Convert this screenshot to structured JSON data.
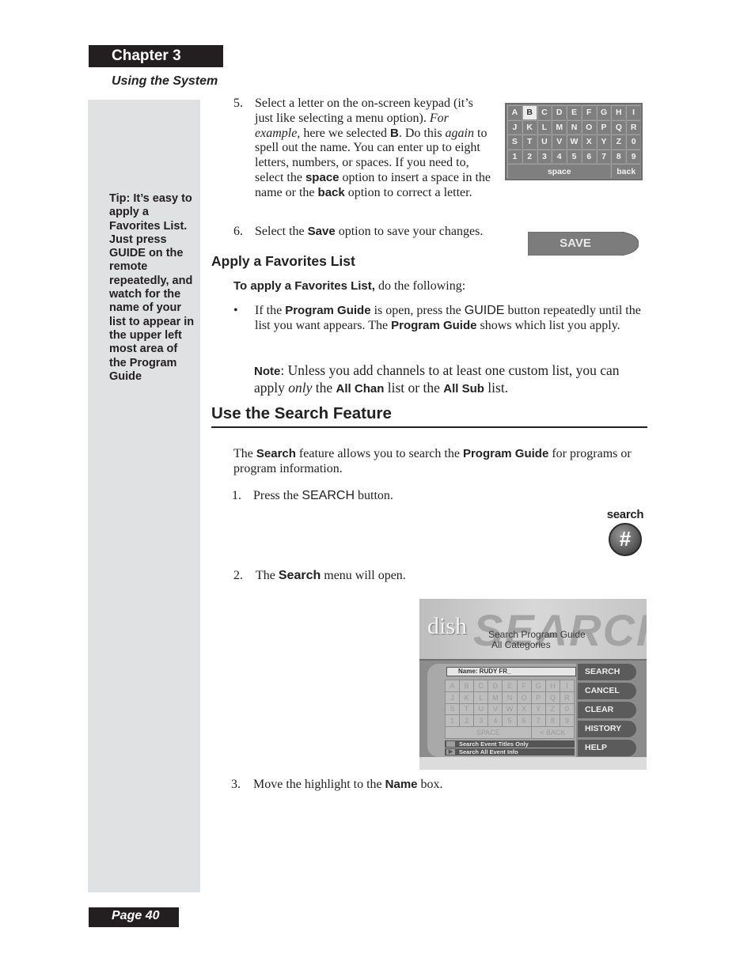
{
  "header": {
    "chapter": "Chapter 3",
    "section": "Using the System"
  },
  "sidebar": {
    "tip": "Tip: It’s easy to apply a Favorites List. Just press GUIDE on the remote repeatedly, and watch for the name of your list to appear in the upper left most area of the Program Guide"
  },
  "step5": {
    "number": "5.",
    "t1": "Select a letter on the on-screen keypad (it’s just like selecting a menu option). ",
    "t2": "For example,",
    "t3": " here we selected ",
    "t4": "B",
    "t5": ". Do this ",
    "t6": "again",
    "t7": " to spell out the name. You can enter up to eight letters, numbers, or spaces. If you need to, select the ",
    "t8": "space",
    "t9": " option to insert a space in the name or the ",
    "t10": "back",
    "t11": " option to correct a letter."
  },
  "keypad": {
    "keys": [
      "A",
      "B",
      "C",
      "D",
      "E",
      "F",
      "G",
      "H",
      "I",
      "J",
      "K",
      "L",
      "M",
      "N",
      "O",
      "P",
      "Q",
      "R",
      "S",
      "T",
      "U",
      "V",
      "W",
      "X",
      "Y",
      "Z",
      "0",
      "1",
      "2",
      "3",
      "4",
      "5",
      "6",
      "7",
      "8",
      "9"
    ],
    "selected": "B",
    "space": "space",
    "back": "back"
  },
  "step6": {
    "number": "6.",
    "t1": "Select the ",
    "t2": "Save",
    "t3": " option to save your changes."
  },
  "save_button": {
    "label": "SAVE"
  },
  "favorites": {
    "heading": "Apply a Favorites List",
    "intro_bold": "To apply a Favorites List,",
    "intro_rest": " do the following:",
    "bullet": "•",
    "b1": "If the ",
    "b2": "Program Guide",
    "b3": " is open, press the ",
    "b4": "GUIDE",
    "b5": " button repeatedly until the list you want appears. The ",
    "b6": "Program Guide",
    "b7": " shows which list you apply.",
    "note_label": "Note",
    "note1": ": Unless you add channels to at least one custom list, you can apply ",
    "note2": "only",
    "note3": " the ",
    "note4": "All Chan",
    "note5": " list or the ",
    "note6": "All Sub",
    "note7": " list."
  },
  "search_feature": {
    "heading": "Use the Search Feature",
    "p1": "The ",
    "p2": "Search",
    "p3": " feature allows you to search the ",
    "p4": "Program Guide",
    "p5": " for programs or program information.",
    "s1_num": "1.",
    "s1a": "Press the ",
    "s1b": "SEARCH",
    "s1c": " button.",
    "s2_num": "2.",
    "s2a": "The ",
    "s2b": "Search",
    "s2c": " menu will open.",
    "s3_num": "3.",
    "s3a": "Move the highlight to the ",
    "s3b": "Name",
    "s3c": " box."
  },
  "remote_button": {
    "label": "search",
    "glyph": "#"
  },
  "search_screen": {
    "logo": "dish",
    "big_word": "SEARCH",
    "title": "Search Program Guide",
    "subtitle": "All Categories",
    "name_field": "Name: RUDY FR_",
    "keys": [
      "A",
      "B",
      "C",
      "D",
      "E",
      "F",
      "G",
      "H",
      "I",
      "J",
      "K",
      "L",
      "M",
      "N",
      "O",
      "P",
      "Q",
      "R",
      "S",
      "T",
      "U",
      "V",
      "W",
      "X",
      "Y",
      "Z",
      "0",
      "1",
      "2",
      "3",
      "4",
      "5",
      "6",
      "7",
      "8",
      "9"
    ],
    "space": "SPACE",
    "back": "< BACK",
    "options": [
      "Search Event Titles Only",
      "Search All Event Info"
    ],
    "selected_option_marker": "▶",
    "menu": [
      "SEARCH",
      "CANCEL",
      "CLEAR",
      "HISTORY",
      "HELP"
    ]
  },
  "footer": {
    "page": "Page 40"
  }
}
